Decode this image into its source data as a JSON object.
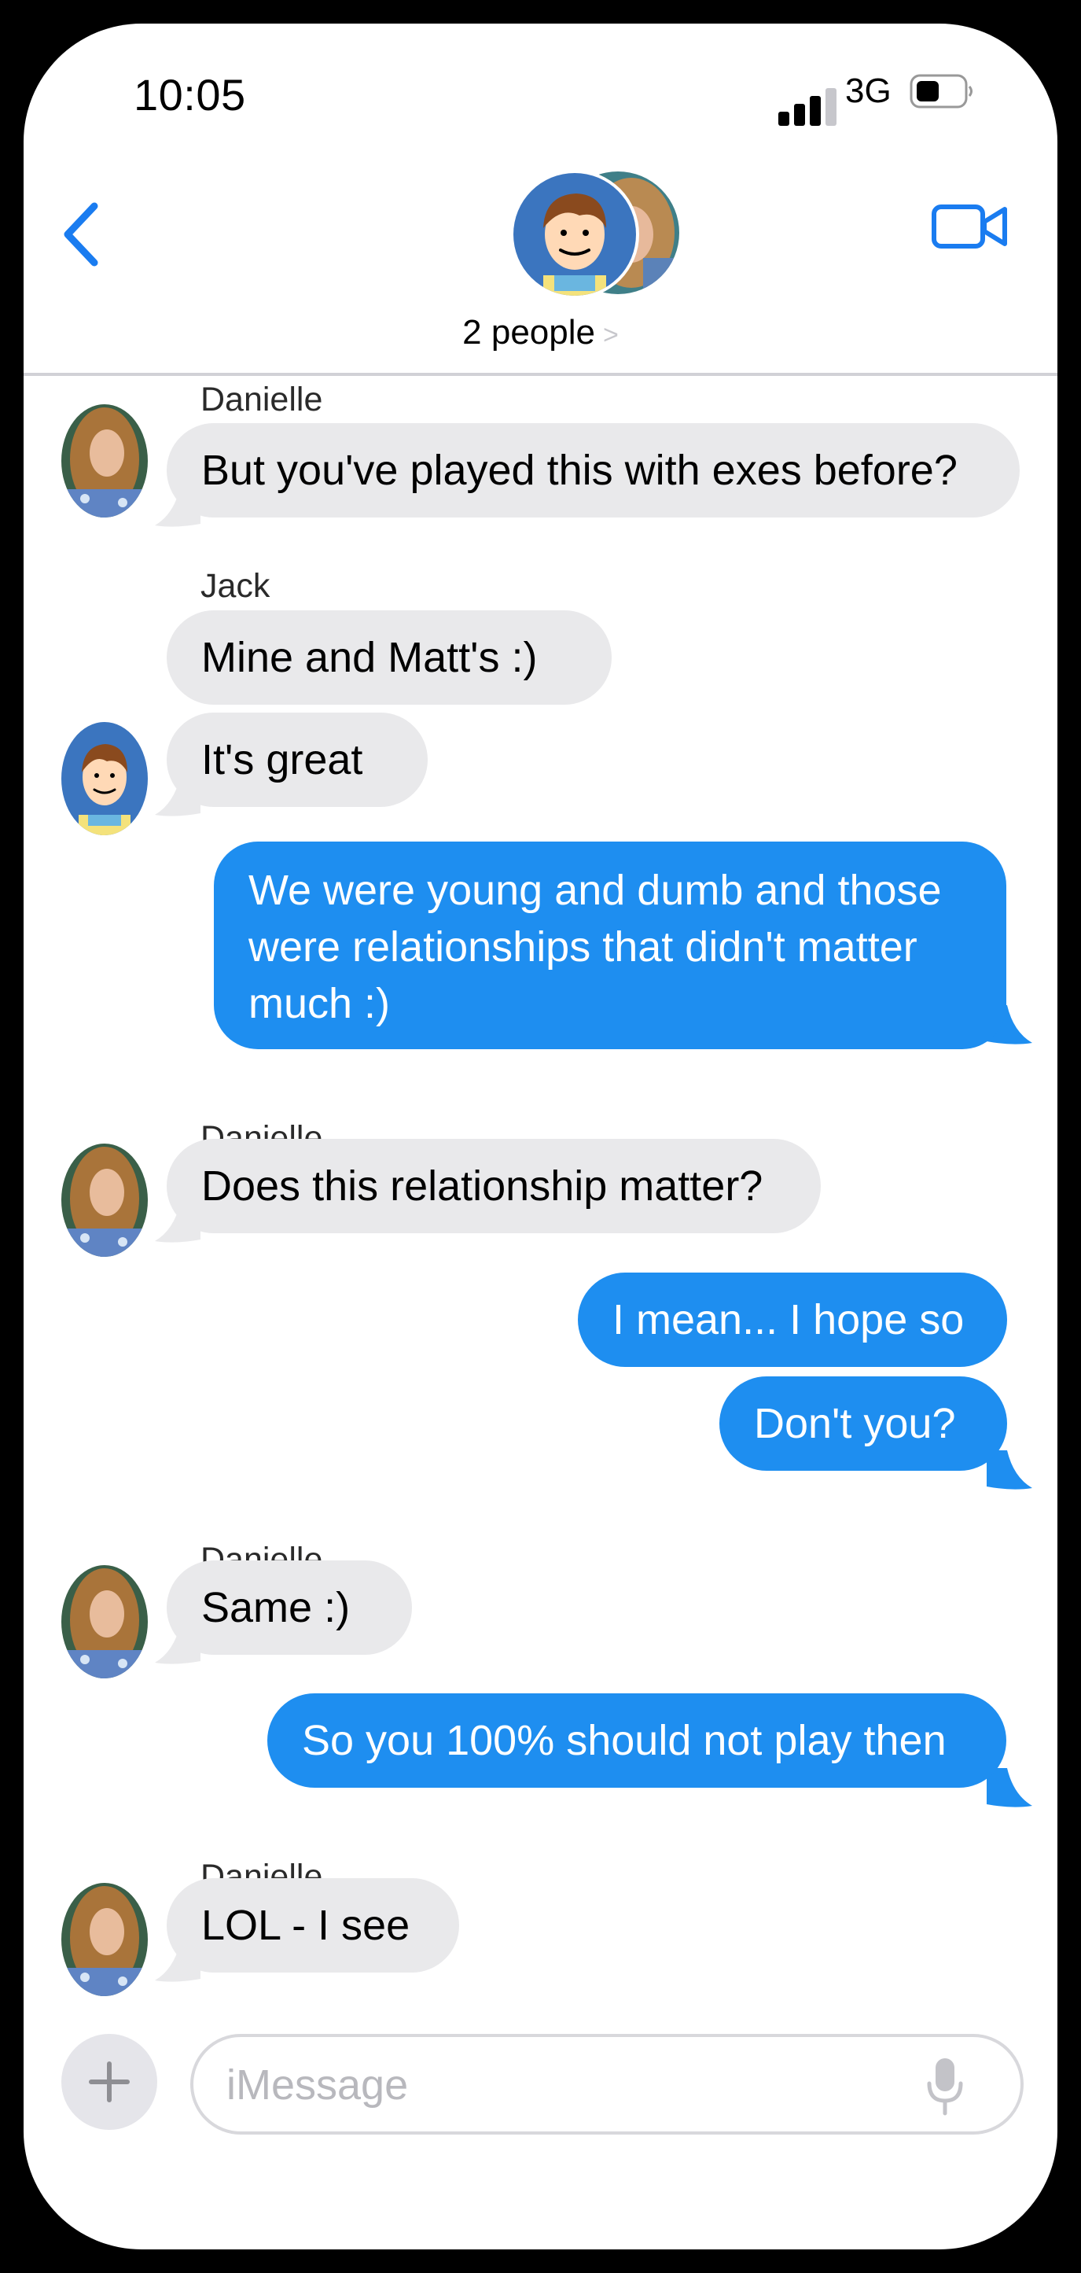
{
  "status_bar": {
    "time": "10:05",
    "network": "3G",
    "icons": [
      "signal-icon",
      "battery-icon"
    ]
  },
  "header": {
    "back_icon": "chevron-left-icon",
    "group_label": "2 people",
    "group_chevron": ">",
    "video_icon": "video-camera-icon"
  },
  "messages": [
    {
      "sender": "Danielle",
      "text": "But you've played this with exes before?",
      "direction": "received"
    },
    {
      "sender": "Jack",
      "text": "Mine and Matt's :)",
      "direction": "received"
    },
    {
      "text": "It's great",
      "direction": "received"
    },
    {
      "text": "We were young and dumb and those were relationships that didn't matter much :)",
      "direction": "sent"
    },
    {
      "sender": "Danielle",
      "text": "Does this relationship matter?",
      "direction": "received"
    },
    {
      "text": "I mean... I hope so",
      "direction": "sent"
    },
    {
      "text": "Don't you?",
      "direction": "sent"
    },
    {
      "sender": "Danielle",
      "text": "Same :)",
      "direction": "received"
    },
    {
      "text": "So you 100% should not play then",
      "direction": "sent"
    },
    {
      "sender": "Danielle",
      "text": "LOL - I see",
      "direction": "received"
    }
  ],
  "composer": {
    "placeholder": "iMessage",
    "icons": [
      "plus-icon",
      "microphone-icon"
    ]
  },
  "colors": {
    "sent_bubble": "#1e8ef0",
    "received_bubble": "#e9e9eb",
    "accent": "#1a7cf0"
  }
}
